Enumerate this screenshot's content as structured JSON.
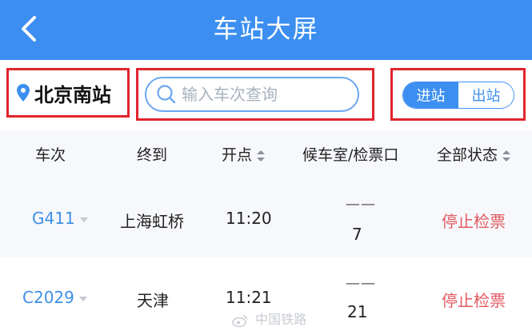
{
  "header": {
    "title": "车站大屏",
    "back_icon": "chevron-left-icon",
    "background_color": "#3c8ff0"
  },
  "station": {
    "name": "北京南站",
    "icon": "location-pin-icon"
  },
  "search": {
    "placeholder": "输入车次查询",
    "value": "",
    "icon": "search-icon"
  },
  "toggle": {
    "options": [
      "进站",
      "出站"
    ],
    "selected": "进站"
  },
  "table": {
    "columns": [
      "车次",
      "终到",
      "开点",
      "候车室/检票口",
      "全部状态"
    ],
    "rows": [
      {
        "train": "G411",
        "destination": "上海虹桥",
        "depart": "11:20",
        "waiting_room": "——",
        "gate": "7",
        "status": "停止检票"
      },
      {
        "train": "C2029",
        "destination": "天津",
        "depart": "11:21",
        "waiting_room": "——",
        "gate": "21",
        "status": "停止检票"
      }
    ]
  },
  "watermark": {
    "text": "中国铁路"
  },
  "colors": {
    "accent": "#3c8ff0",
    "status_stopped": "#e35a62",
    "highlight_frame": "#e1242c"
  }
}
